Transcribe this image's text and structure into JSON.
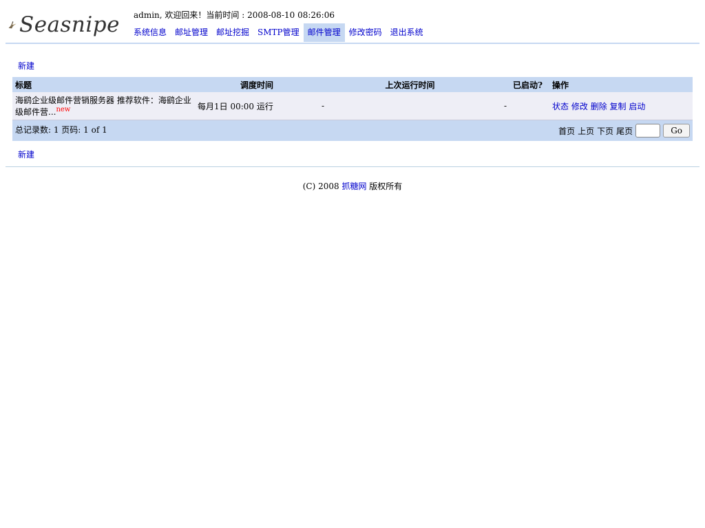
{
  "header": {
    "logo_text": "Seasnipe",
    "welcome": "admin, 欢迎回来！当前时间 : 2008-08-10 08:26:06"
  },
  "nav": [
    {
      "label": "系统信息"
    },
    {
      "label": "邮址管理"
    },
    {
      "label": "邮址挖掘"
    },
    {
      "label": "SMTP管理"
    },
    {
      "label": "邮件管理",
      "active": true
    },
    {
      "label": "修改密码"
    },
    {
      "label": "退出系统"
    }
  ],
  "actions": {
    "new_label": "新建"
  },
  "table": {
    "headers": [
      "标题",
      "调度时间",
      "上次运行时间",
      "已启动?",
      "操作"
    ],
    "rows": [
      {
        "title": "海鹞企业级邮件营销服务器 推荐软件：海鹞企业级邮件营...",
        "badge": "new",
        "schedule": "每月1日 00:00 运行",
        "last_run": "-",
        "started": "-",
        "ops": [
          "状态",
          "修改",
          "删除",
          "复制",
          "启动"
        ]
      }
    ],
    "pager": {
      "summary": "总记录数: 1 页码: 1 of 1",
      "first": "首页",
      "prev": "上页",
      "next": "下页",
      "last": "尾页",
      "input_value": "",
      "go_label": "Go"
    }
  },
  "footer": {
    "prefix": "(C) 2008 ",
    "link": "抓糖网",
    "suffix": " 版权所有"
  }
}
